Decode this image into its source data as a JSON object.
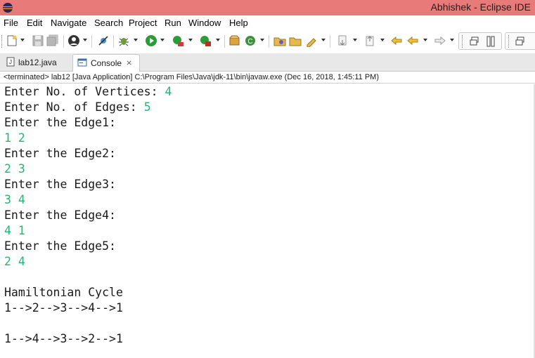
{
  "window": {
    "title": "Abhishek - Eclipse IDE"
  },
  "menu": {
    "items": [
      "File",
      "Edit",
      "Navigate",
      "Search",
      "Project",
      "Run",
      "Window",
      "Help"
    ]
  },
  "tabs": [
    {
      "label": "lab12.java",
      "active": false,
      "icon": "java-file-icon"
    },
    {
      "label": "Console",
      "active": true,
      "icon": "console-icon"
    }
  ],
  "console": {
    "status": "<terminated> lab12 [Java Application] C:\\Program Files\\Java\\jdk-11\\bin\\javaw.exe (Dec 16, 2018, 1:45:11 PM)",
    "lines": [
      {
        "prompt": "Enter No. of Vertices: ",
        "input": "4"
      },
      {
        "prompt": "Enter No. of Edges: ",
        "input": "5"
      },
      {
        "prompt": "Enter the Edge1:",
        "input": ""
      },
      {
        "prompt": "",
        "input": "1 2"
      },
      {
        "prompt": "Enter the Edge2:",
        "input": ""
      },
      {
        "prompt": "",
        "input": "2 3"
      },
      {
        "prompt": "Enter the Edge3:",
        "input": ""
      },
      {
        "prompt": "",
        "input": "3 4"
      },
      {
        "prompt": "Enter the Edge4:",
        "input": ""
      },
      {
        "prompt": "",
        "input": "4 1"
      },
      {
        "prompt": "Enter the Edge5:",
        "input": ""
      },
      {
        "prompt": "",
        "input": "2 4"
      },
      {
        "prompt": "",
        "input": ""
      },
      {
        "prompt": "Hamiltonian Cycle",
        "input": ""
      },
      {
        "prompt": "1-->2-->3-->4-->1",
        "input": ""
      },
      {
        "prompt": "",
        "input": ""
      },
      {
        "prompt": "1-->4-->3-->2-->1",
        "input": ""
      }
    ]
  },
  "colors": {
    "titlebar": "#e87a7a",
    "input_text": "#22b573",
    "output_text": "#1a1a1a"
  }
}
